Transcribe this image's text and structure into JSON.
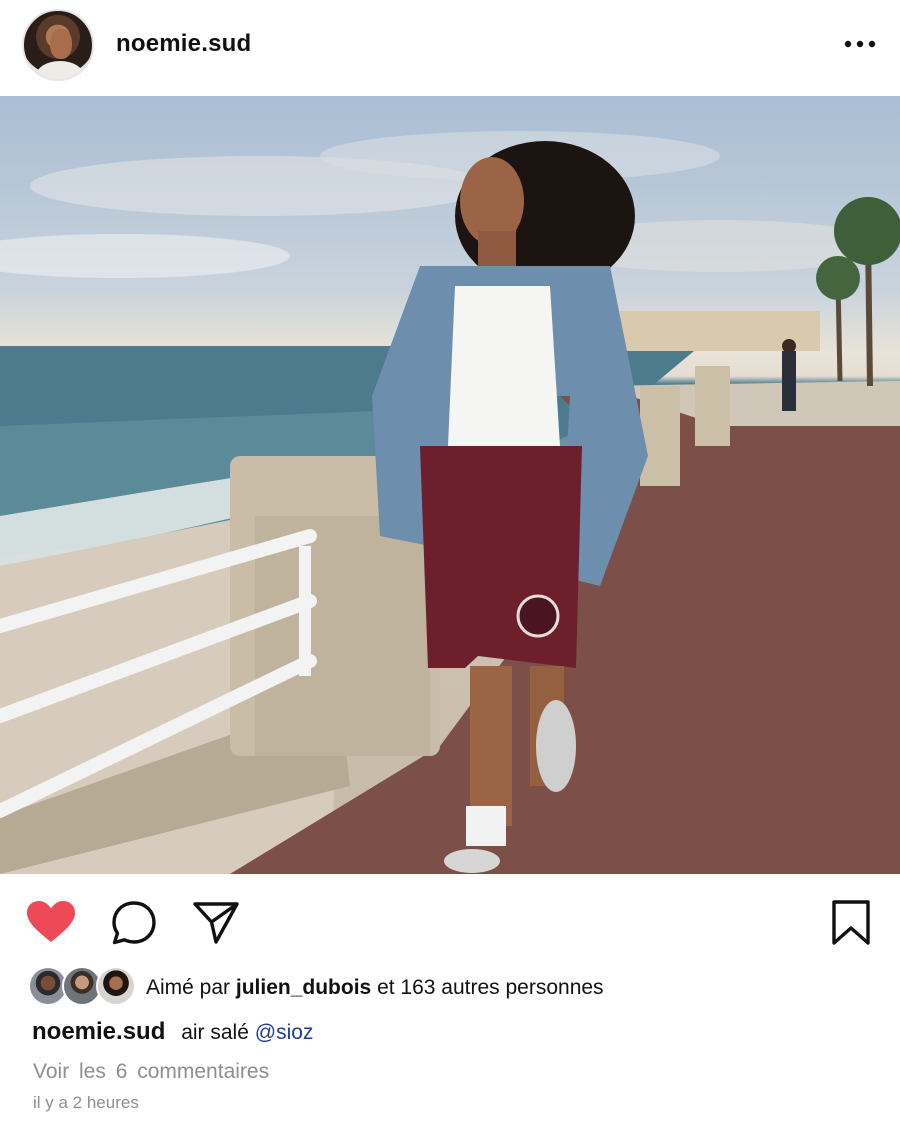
{
  "post": {
    "username": "noemie.sud",
    "photo_alt": "",
    "caption_user": "noemie.sud",
    "caption_text": "air salé",
    "caption_mention": "@sioz",
    "likes_prefix": "Aimé par",
    "likes_user": "julien_dubois",
    "likes_suffix": "et 163 autres personnes",
    "comments_link": "Voir les 6 commentaires",
    "timestamp": "il y a 2 heures",
    "liked": true
  },
  "icons": {
    "more": "more-options-icon",
    "like": "heart-icon",
    "comment": "comment-icon",
    "share": "paper-plane-icon",
    "save": "bookmark-icon"
  },
  "colors": {
    "like": "#ed4956",
    "mention": "#1f3f8f",
    "muted": "#8e8e8e"
  }
}
